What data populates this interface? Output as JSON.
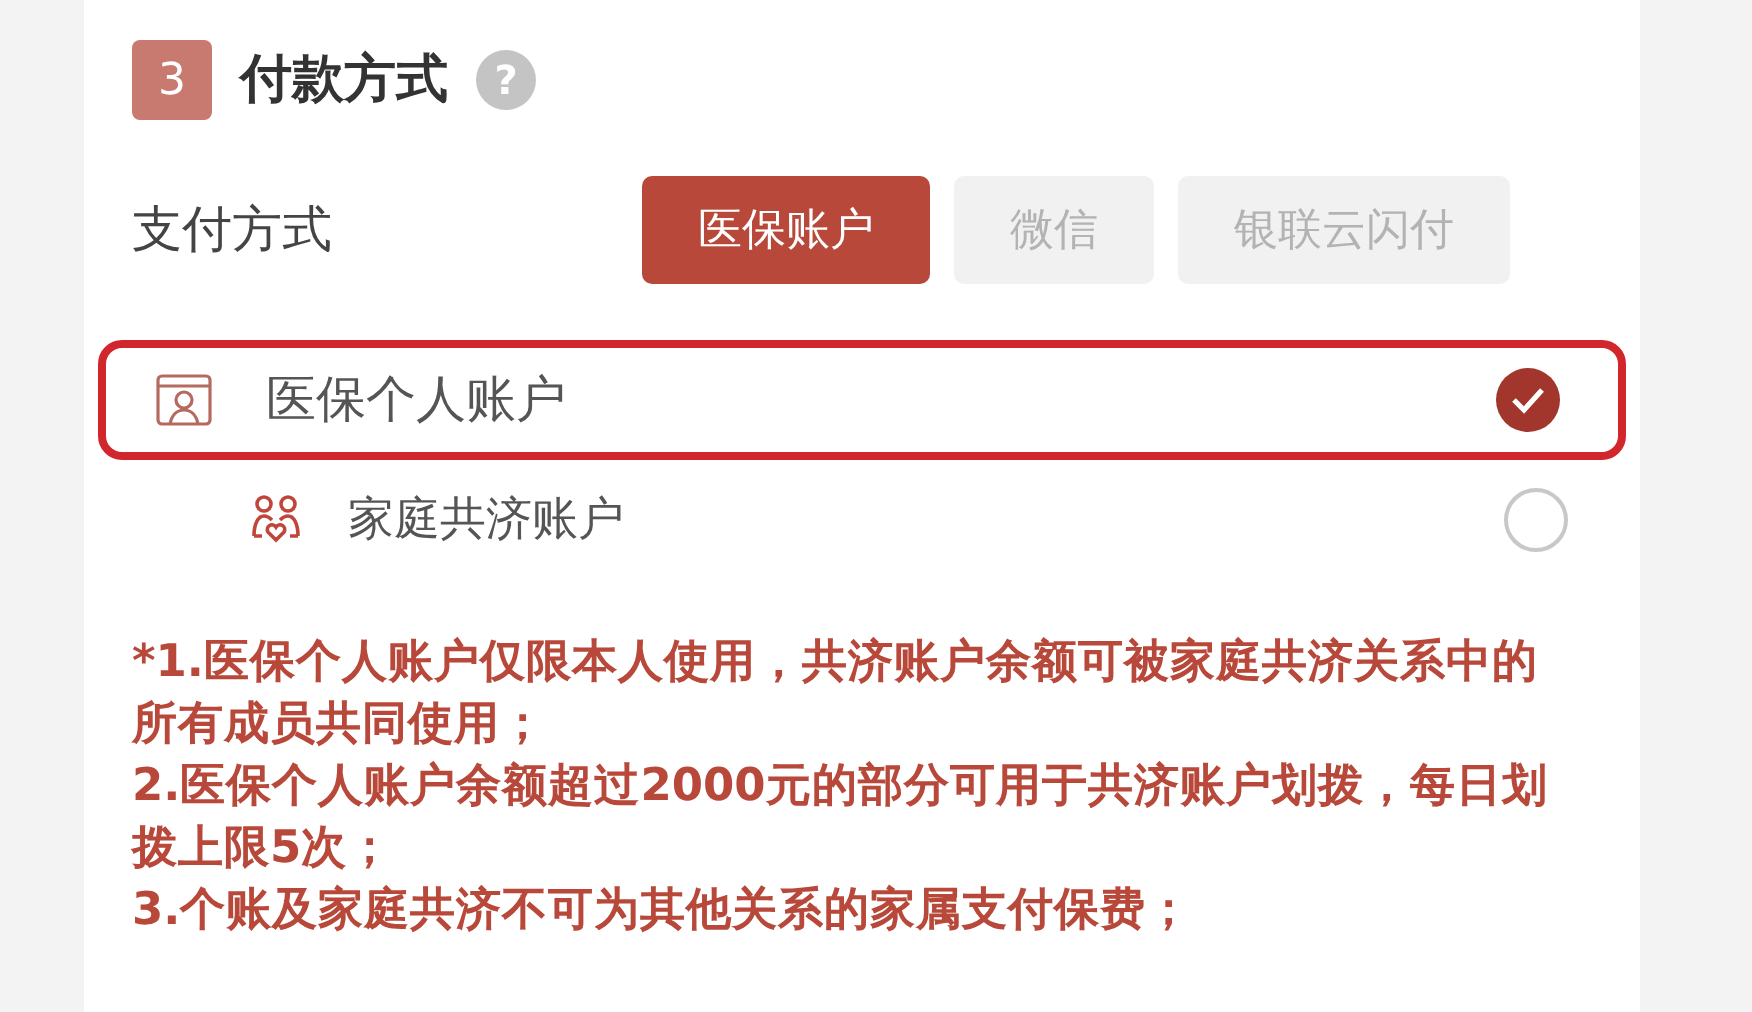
{
  "section": {
    "number": "3",
    "title": "付款方式",
    "help": "?"
  },
  "payment": {
    "label": "支付方式",
    "options": [
      {
        "label": "医保账户",
        "selected": true
      },
      {
        "label": "微信",
        "selected": false
      },
      {
        "label": "银联云闪付",
        "selected": false
      }
    ]
  },
  "accounts": [
    {
      "kind": "personal",
      "label": "医保个人账户",
      "selected": true
    },
    {
      "kind": "family",
      "label": "家庭共济账户",
      "selected": false
    }
  ],
  "notes": [
    "*1.医保个人账户仅限本人使用，共济账户余额可被家庭共济关系中的所有成员共同使用；",
    "2.医保个人账户余额超过2000元的部分可用于共济账户划拨，每日划拨上限5次；",
    "3.个账及家庭共济不可为其他关系的家属支付保费；"
  ]
}
